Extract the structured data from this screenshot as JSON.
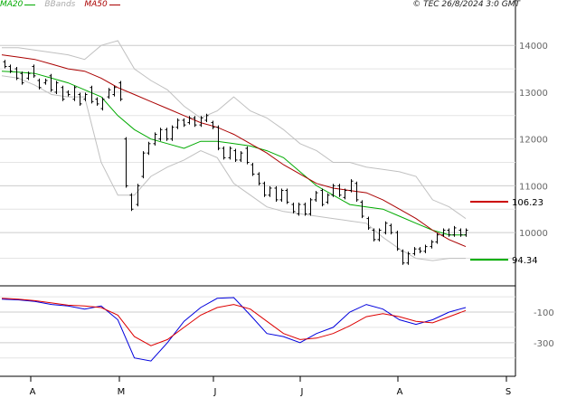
{
  "header": {
    "copyright": "© TEC 26/8/2024 3:0 GMT"
  },
  "legend": [
    {
      "label": "MA20",
      "color": "#00aa00"
    },
    {
      "label": "BBands",
      "color": "#aaaaaa"
    },
    {
      "label": "MA50",
      "color": "#aa0000"
    }
  ],
  "colors": {
    "price": "#000000",
    "ma20": "#00aa00",
    "ma50": "#aa0000",
    "bbands": "#c0c0c0",
    "macd": "#0000dd",
    "signal": "#dd0000",
    "grid": "#cccccc"
  },
  "chart_data": [
    {
      "type": "line",
      "panel": "price",
      "ylim": [
        8900,
        14700
      ],
      "yticks": [
        {
          "value": 14000,
          "label": "14000"
        },
        {
          "value": 13000,
          "label": "13000"
        },
        {
          "value": 12000,
          "label": "12000"
        },
        {
          "value": 11000,
          "label": "11000"
        },
        {
          "value": 10000,
          "label": "10000"
        }
      ],
      "xlabels": [
        "A",
        "M",
        "J",
        "J",
        "A",
        "S"
      ],
      "ma_labels": [
        {
          "text": "106.23",
          "value": 10660,
          "color": "#cc0000"
        },
        {
          "text": "94.34",
          "value": 9420,
          "color": "#00aa00"
        }
      ],
      "ohlc": [
        [
          13650,
          13550
        ],
        [
          13550,
          13450
        ],
        [
          13500,
          13300
        ],
        [
          13400,
          13200
        ],
        [
          13300,
          13400
        ],
        [
          13550,
          13350
        ],
        [
          13250,
          13100
        ],
        [
          13200,
          13250
        ],
        [
          13350,
          13050
        ],
        [
          13000,
          13200
        ],
        [
          13100,
          12850
        ],
        [
          13000,
          12950
        ],
        [
          12850,
          13100
        ],
        [
          12950,
          12750
        ],
        [
          12850,
          12950
        ],
        [
          13100,
          12800
        ],
        [
          12850,
          12750
        ],
        [
          12650,
          12850
        ],
        [
          12900,
          13050
        ],
        [
          12950,
          13100
        ],
        [
          13200,
          12850
        ],
        [
          12000,
          11000
        ],
        [
          10800,
          10500
        ],
        [
          10600,
          11000
        ],
        [
          11200,
          11700
        ],
        [
          11700,
          11900
        ],
        [
          11900,
          12100
        ],
        [
          12000,
          12200
        ],
        [
          12200,
          12000
        ],
        [
          12000,
          12250
        ],
        [
          12250,
          12400
        ],
        [
          12400,
          12300
        ],
        [
          12350,
          12450
        ],
        [
          12450,
          12300
        ],
        [
          12300,
          12450
        ],
        [
          12400,
          12500
        ],
        [
          12350,
          12250
        ],
        [
          12250,
          11800
        ],
        [
          11800,
          11600
        ],
        [
          11600,
          11800
        ],
        [
          11750,
          11550
        ],
        [
          11550,
          11700
        ],
        [
          11800,
          11500
        ],
        [
          11450,
          11250
        ],
        [
          11250,
          11050
        ],
        [
          11050,
          10800
        ],
        [
          10800,
          10950
        ],
        [
          10950,
          10700
        ],
        [
          10700,
          10900
        ],
        [
          10900,
          10650
        ],
        [
          10600,
          10450
        ],
        [
          10400,
          10600
        ],
        [
          10600,
          10400
        ],
        [
          10400,
          10700
        ],
        [
          10700,
          10850
        ],
        [
          10900,
          10600
        ],
        [
          10650,
          10800
        ],
        [
          10800,
          11000
        ],
        [
          11000,
          10800
        ],
        [
          10750,
          10900
        ],
        [
          10900,
          11100
        ],
        [
          11050,
          10700
        ],
        [
          10650,
          10350
        ],
        [
          10300,
          10100
        ],
        [
          10050,
          9850
        ],
        [
          9850,
          10050
        ],
        [
          10000,
          10200
        ],
        [
          10150,
          10000
        ],
        [
          10000,
          9650
        ],
        [
          9600,
          9350
        ],
        [
          9350,
          9550
        ],
        [
          9550,
          9650
        ],
        [
          9650,
          9600
        ],
        [
          9600,
          9700
        ],
        [
          9700,
          9800
        ],
        [
          9800,
          9950
        ],
        [
          9950,
          10050
        ],
        [
          10050,
          9950
        ],
        [
          9950,
          10100
        ],
        [
          10050,
          9950
        ],
        [
          9950,
          10050
        ]
      ],
      "series": [
        {
          "name": "MA20",
          "color": "#00aa00",
          "values": [
            13450,
            13430,
            13400,
            13300,
            13200,
            13050,
            12900,
            12500,
            12200,
            12000,
            11900,
            11800,
            11950,
            11950,
            11900,
            11850,
            11750,
            11600,
            11300,
            11000,
            10800,
            10600,
            10550,
            10500,
            10350,
            10200,
            10050,
            9950,
            9950
          ]
        },
        {
          "name": "BBands upper",
          "color": "#c0c0c0",
          "values": [
            13950,
            13950,
            13900,
            13850,
            13800,
            13700,
            14000,
            14100,
            13500,
            13250,
            13050,
            12700,
            12450,
            12600,
            12900,
            12600,
            12450,
            12200,
            11900,
            11750,
            11500,
            11500,
            11400,
            11350,
            11300,
            11200,
            10700,
            10550,
            10300
          ]
        },
        {
          "name": "BBands lower",
          "color": "#c0c0c0",
          "values": [
            13350,
            13300,
            13150,
            12950,
            12900,
            12900,
            11500,
            10800,
            10800,
            11200,
            11400,
            11550,
            11750,
            11600,
            11050,
            10800,
            10550,
            10450,
            10400,
            10350,
            10300,
            10250,
            10200,
            9900,
            9650,
            9450,
            9400,
            9450,
            9450
          ]
        },
        {
          "name": "MA50",
          "color": "#aa0000",
          "values": [
            13800,
            13750,
            13700,
            13600,
            13500,
            13450,
            13300,
            13100,
            12950,
            12800,
            12650,
            12500,
            12350,
            12250,
            12100,
            11900,
            11700,
            11450,
            11250,
            11050,
            10950,
            10900,
            10850,
            10700,
            10500,
            10300,
            10050,
            9850,
            9700
          ]
        }
      ]
    },
    {
      "type": "line",
      "panel": "macd",
      "ylim": [
        -520,
        60
      ],
      "yticks": [
        {
          "value": -100,
          "label": "-100"
        },
        {
          "value": -300,
          "label": "-300"
        }
      ],
      "series": [
        {
          "name": "MACD",
          "color": "#0000dd",
          "values": [
            -15,
            -20,
            -30,
            -50,
            -60,
            -80,
            -60,
            -150,
            -400,
            -420,
            -300,
            -160,
            -70,
            -10,
            -5,
            -120,
            -240,
            -260,
            -300,
            -240,
            -200,
            -100,
            -50,
            -80,
            -150,
            -180,
            -150,
            -100,
            -70
          ]
        },
        {
          "name": "Signal",
          "color": "#dd0000",
          "values": [
            -10,
            -15,
            -25,
            -40,
            -55,
            -60,
            -70,
            -120,
            -260,
            -320,
            -280,
            -200,
            -120,
            -70,
            -50,
            -80,
            -160,
            -240,
            -280,
            -270,
            -240,
            -190,
            -130,
            -110,
            -130,
            -160,
            -170,
            -130,
            -90
          ]
        }
      ]
    }
  ]
}
